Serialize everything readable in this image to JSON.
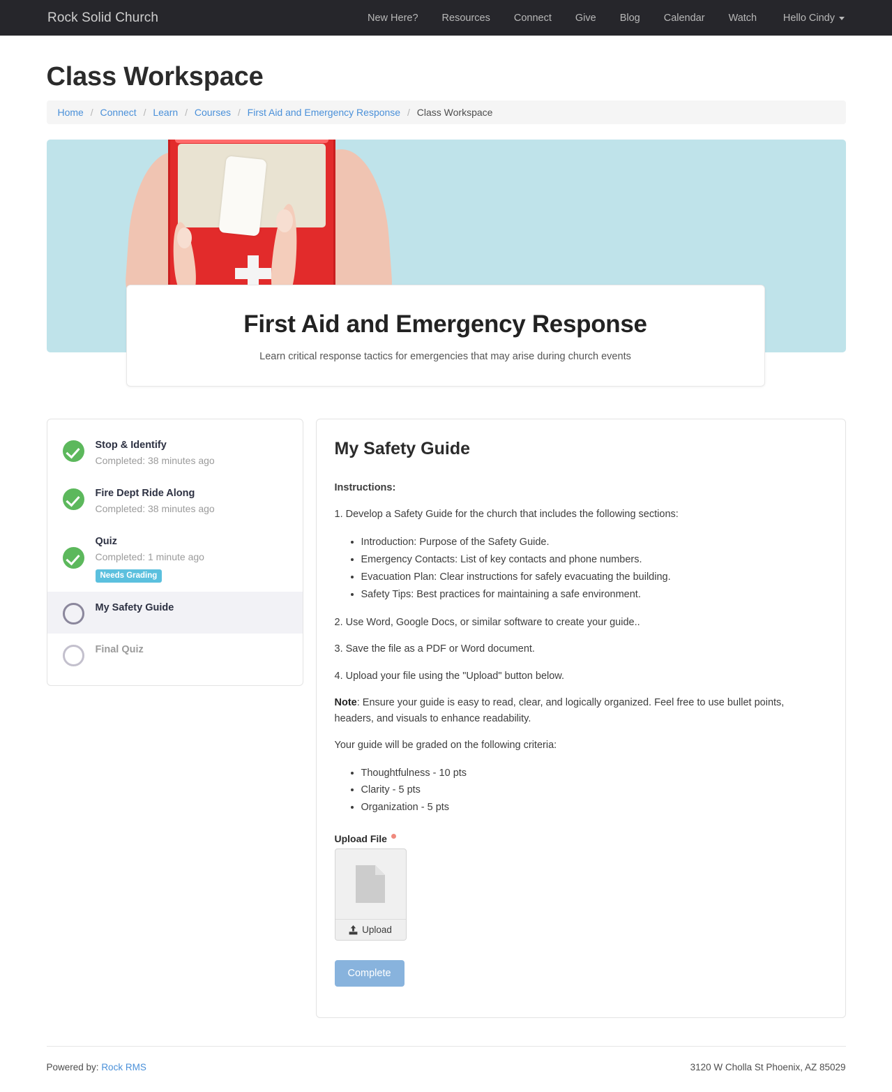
{
  "navbar": {
    "brand": "Rock Solid Church",
    "links": [
      {
        "label": "New Here?"
      },
      {
        "label": "Resources"
      },
      {
        "label": "Connect"
      },
      {
        "label": "Give"
      },
      {
        "label": "Blog"
      },
      {
        "label": "Calendar"
      },
      {
        "label": "Watch"
      }
    ],
    "user_menu": "Hello Cindy",
    "bg_color": "#26262b"
  },
  "page": {
    "title": "Class Workspace"
  },
  "breadcrumb": {
    "items": [
      {
        "label": "Home",
        "link": true
      },
      {
        "label": "Connect",
        "link": true
      },
      {
        "label": "Learn",
        "link": true
      },
      {
        "label": "Courses",
        "link": true
      },
      {
        "label": "First Aid and Emergency Response",
        "link": true
      },
      {
        "label": "Class Workspace",
        "link": false
      }
    ],
    "separator": "/"
  },
  "hero": {
    "image_alt": "hands holding an open red first aid kit with gauze roll on light blue background",
    "bg_color": "#bfe3ea",
    "title": "First Aid and Emergency Response",
    "subtitle": "Learn critical response tactics for emergencies that may arise during church events"
  },
  "activities": {
    "items": [
      {
        "title": "Stop & Identify",
        "status": "Completed: 38 minutes ago",
        "state": "complete",
        "badge": null,
        "selected": false
      },
      {
        "title": "Fire Dept Ride Along",
        "status": "Completed: 38 minutes ago",
        "state": "complete",
        "badge": null,
        "selected": false
      },
      {
        "title": "Quiz",
        "status": "Completed: 1 minute ago",
        "state": "complete",
        "badge": "Needs Grading",
        "selected": false
      },
      {
        "title": "My Safety Guide",
        "status": null,
        "state": "current",
        "badge": null,
        "selected": true
      },
      {
        "title": "Final Quiz",
        "status": null,
        "state": "locked",
        "badge": null,
        "selected": false
      }
    ],
    "complete_color": "#5cb85c",
    "badge_color": "#5bc0de",
    "selected_bg": "#f2f2f6"
  },
  "assignment": {
    "heading": "My Safety Guide",
    "instructions_label": "Instructions:",
    "step1": "1. Develop a Safety Guide for the church that includes the following sections:",
    "sections": [
      "Introduction: Purpose of the Safety Guide.",
      "Emergency Contacts: List of key contacts and phone numbers.",
      "Evacuation Plan: Clear instructions for safely evacuating the building.",
      "Safety Tips: Best practices for maintaining a safe environment."
    ],
    "step2": "2. Use Word, Google Docs, or similar software to create your guide..",
    "step3": "3. Save the file as a PDF or Word document.",
    "step4": "4. Upload your file using the \"Upload\" button below.",
    "note_label": "Note",
    "note_text": ": Ensure your guide is easy to read, clear, and logically organized. Feel free to use bullet points, headers, and visuals to enhance readability.",
    "criteria_intro": "Your guide will be graded on the following criteria:",
    "criteria": [
      "Thoughtfulness - 10 pts",
      "Clarity - 5 pts",
      "Organization - 5 pts"
    ],
    "upload_label": "Upload File",
    "upload_required": true,
    "upload_button": "Upload",
    "complete_button": "Complete",
    "complete_button_color": "#88b3dd"
  },
  "footer": {
    "powered_by_prefix": "Powered by:",
    "powered_by_link": "Rock RMS",
    "address": "3120 W Cholla St Phoenix, AZ 85029"
  }
}
